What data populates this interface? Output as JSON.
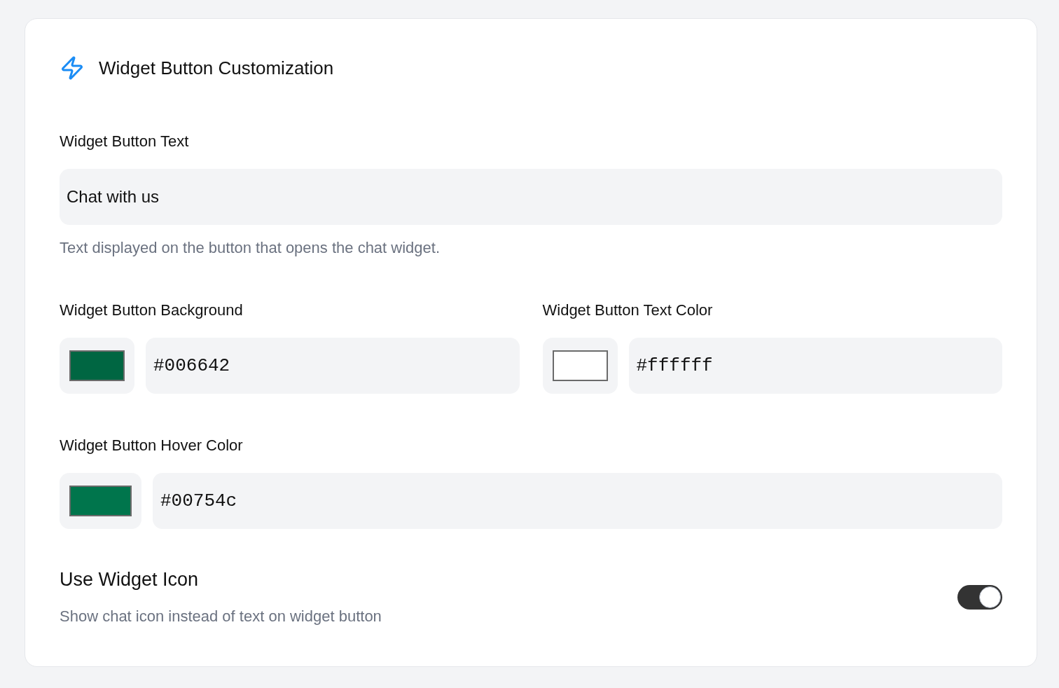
{
  "section": {
    "title": "Widget Button Customization"
  },
  "text_field": {
    "label": "Widget Button Text",
    "value": "Chat with us",
    "help": "Text displayed on the button that opens the chat widget."
  },
  "color_rows": [
    {
      "fields": [
        {
          "label": "Widget Button Background",
          "color": "#006642",
          "value": "#006642"
        },
        {
          "label": "Widget Button Text Color",
          "color": "#ffffff",
          "value": "#ffffff"
        }
      ]
    },
    {
      "fields": [
        {
          "label": "Widget Button Hover Color",
          "color": "#00754c",
          "value": "#00754c"
        }
      ]
    }
  ],
  "toggle": {
    "label": "Use Widget Icon",
    "description": "Show chat icon instead of text on widget button",
    "on": true
  }
}
